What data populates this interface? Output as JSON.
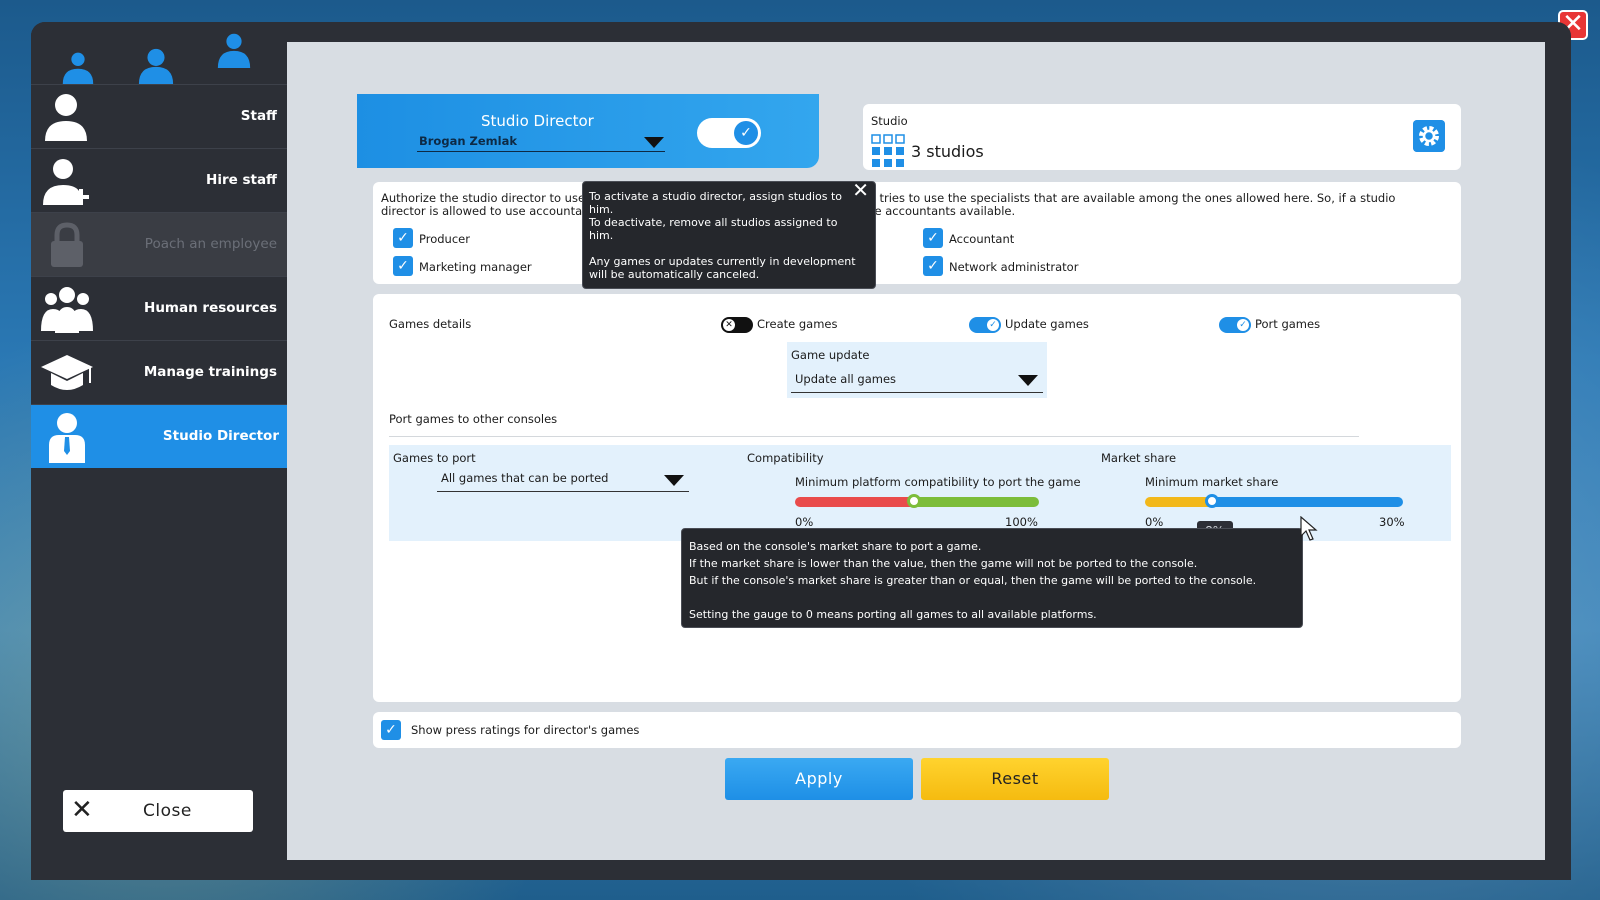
{
  "sidebar": {
    "items": [
      {
        "label": "Staff",
        "icon": "person-icon"
      },
      {
        "label": "Hire staff",
        "icon": "add-person-icon"
      },
      {
        "label": "Poach an employee",
        "icon": "lock-icon"
      },
      {
        "label": "Human resources",
        "icon": "group-icon"
      },
      {
        "label": "Manage trainings",
        "icon": "graduation-cap-icon"
      },
      {
        "label": "Studio Director",
        "icon": "businessman-icon"
      }
    ],
    "close_label": "Close"
  },
  "director": {
    "title": "Studio Director",
    "selected_name": "Brogan Zemlak",
    "enabled": true
  },
  "studio": {
    "label": "Studio",
    "value": "3 studios"
  },
  "auth": {
    "desc_left_1": "Authorize the studio director to use",
    "desc_left_2": "director is allowed to use accountan",
    "desc_right_1": "ys tries to use the specialists that are available among the ones allowed here. So, if a studio",
    "desc_right_2": "are accountants available.",
    "producer": "Producer",
    "marketing": "Marketing manager",
    "accountant": "Accountant",
    "network": "Network administrator"
  },
  "games": {
    "details_label": "Games details",
    "create_label": "Create games",
    "update_label": "Update games",
    "port_label": "Port games",
    "update_box_label": "Game update",
    "update_value": "Update all games",
    "port_section_title": "Port games to other consoles",
    "to_port_label": "Games to port",
    "to_port_value": "All games that can be ported",
    "compat_label": "Compatibility",
    "compat_sub": "Minimum platform compatibility to port the game",
    "compat_min": "0%",
    "compat_max": "100%",
    "compat_level": 0.5,
    "share_label": "Market share",
    "share_sub": "Minimum market share",
    "share_min": "0%",
    "share_max": "30%",
    "share_value": "8%",
    "share_level": 0.27
  },
  "press": {
    "label": "Show press ratings for director's games"
  },
  "buttons": {
    "apply": "Apply",
    "reset": "Reset"
  },
  "tooltip1": {
    "line1": "To activate a studio director, assign studios to",
    "line2": "him.",
    "line3": "To deactivate, remove all studios assigned to",
    "line4": "him.",
    "line5": "Any games or updates currently in development",
    "line6": "will be automatically canceled."
  },
  "tooltip2": {
    "line1": "Based on the console's market share to port a game.",
    "line2": "If the market share is lower than the value, then the game will not be ported to the console.",
    "line3": "But if the console's market share is greater than or equal, then the game will be ported to the console.",
    "line4": "Setting the gauge to 0 means porting all games to all available platforms."
  },
  "colors": {
    "accent": "#1f8fe6",
    "apply": "#2b9cee",
    "reset": "#f8c51c",
    "danger": "#e83535",
    "compat_low": "#e94b4b",
    "compat_high": "#7cbd3a",
    "share_low": "#f2b81a"
  }
}
